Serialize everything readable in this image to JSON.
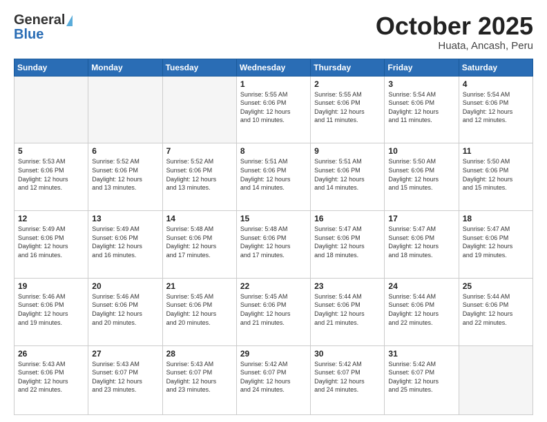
{
  "header": {
    "logo_general": "General",
    "logo_blue": "Blue",
    "month_title": "October 2025",
    "location": "Huata, Ancash, Peru"
  },
  "days_of_week": [
    "Sunday",
    "Monday",
    "Tuesday",
    "Wednesday",
    "Thursday",
    "Friday",
    "Saturday"
  ],
  "weeks": [
    [
      {
        "day": "",
        "info": ""
      },
      {
        "day": "",
        "info": ""
      },
      {
        "day": "",
        "info": ""
      },
      {
        "day": "1",
        "info": "Sunrise: 5:55 AM\nSunset: 6:06 PM\nDaylight: 12 hours\nand 10 minutes."
      },
      {
        "day": "2",
        "info": "Sunrise: 5:55 AM\nSunset: 6:06 PM\nDaylight: 12 hours\nand 11 minutes."
      },
      {
        "day": "3",
        "info": "Sunrise: 5:54 AM\nSunset: 6:06 PM\nDaylight: 12 hours\nand 11 minutes."
      },
      {
        "day": "4",
        "info": "Sunrise: 5:54 AM\nSunset: 6:06 PM\nDaylight: 12 hours\nand 12 minutes."
      }
    ],
    [
      {
        "day": "5",
        "info": "Sunrise: 5:53 AM\nSunset: 6:06 PM\nDaylight: 12 hours\nand 12 minutes."
      },
      {
        "day": "6",
        "info": "Sunrise: 5:52 AM\nSunset: 6:06 PM\nDaylight: 12 hours\nand 13 minutes."
      },
      {
        "day": "7",
        "info": "Sunrise: 5:52 AM\nSunset: 6:06 PM\nDaylight: 12 hours\nand 13 minutes."
      },
      {
        "day": "8",
        "info": "Sunrise: 5:51 AM\nSunset: 6:06 PM\nDaylight: 12 hours\nand 14 minutes."
      },
      {
        "day": "9",
        "info": "Sunrise: 5:51 AM\nSunset: 6:06 PM\nDaylight: 12 hours\nand 14 minutes."
      },
      {
        "day": "10",
        "info": "Sunrise: 5:50 AM\nSunset: 6:06 PM\nDaylight: 12 hours\nand 15 minutes."
      },
      {
        "day": "11",
        "info": "Sunrise: 5:50 AM\nSunset: 6:06 PM\nDaylight: 12 hours\nand 15 minutes."
      }
    ],
    [
      {
        "day": "12",
        "info": "Sunrise: 5:49 AM\nSunset: 6:06 PM\nDaylight: 12 hours\nand 16 minutes."
      },
      {
        "day": "13",
        "info": "Sunrise: 5:49 AM\nSunset: 6:06 PM\nDaylight: 12 hours\nand 16 minutes."
      },
      {
        "day": "14",
        "info": "Sunrise: 5:48 AM\nSunset: 6:06 PM\nDaylight: 12 hours\nand 17 minutes."
      },
      {
        "day": "15",
        "info": "Sunrise: 5:48 AM\nSunset: 6:06 PM\nDaylight: 12 hours\nand 17 minutes."
      },
      {
        "day": "16",
        "info": "Sunrise: 5:47 AM\nSunset: 6:06 PM\nDaylight: 12 hours\nand 18 minutes."
      },
      {
        "day": "17",
        "info": "Sunrise: 5:47 AM\nSunset: 6:06 PM\nDaylight: 12 hours\nand 18 minutes."
      },
      {
        "day": "18",
        "info": "Sunrise: 5:47 AM\nSunset: 6:06 PM\nDaylight: 12 hours\nand 19 minutes."
      }
    ],
    [
      {
        "day": "19",
        "info": "Sunrise: 5:46 AM\nSunset: 6:06 PM\nDaylight: 12 hours\nand 19 minutes."
      },
      {
        "day": "20",
        "info": "Sunrise: 5:46 AM\nSunset: 6:06 PM\nDaylight: 12 hours\nand 20 minutes."
      },
      {
        "day": "21",
        "info": "Sunrise: 5:45 AM\nSunset: 6:06 PM\nDaylight: 12 hours\nand 20 minutes."
      },
      {
        "day": "22",
        "info": "Sunrise: 5:45 AM\nSunset: 6:06 PM\nDaylight: 12 hours\nand 21 minutes."
      },
      {
        "day": "23",
        "info": "Sunrise: 5:44 AM\nSunset: 6:06 PM\nDaylight: 12 hours\nand 21 minutes."
      },
      {
        "day": "24",
        "info": "Sunrise: 5:44 AM\nSunset: 6:06 PM\nDaylight: 12 hours\nand 22 minutes."
      },
      {
        "day": "25",
        "info": "Sunrise: 5:44 AM\nSunset: 6:06 PM\nDaylight: 12 hours\nand 22 minutes."
      }
    ],
    [
      {
        "day": "26",
        "info": "Sunrise: 5:43 AM\nSunset: 6:06 PM\nDaylight: 12 hours\nand 22 minutes."
      },
      {
        "day": "27",
        "info": "Sunrise: 5:43 AM\nSunset: 6:07 PM\nDaylight: 12 hours\nand 23 minutes."
      },
      {
        "day": "28",
        "info": "Sunrise: 5:43 AM\nSunset: 6:07 PM\nDaylight: 12 hours\nand 23 minutes."
      },
      {
        "day": "29",
        "info": "Sunrise: 5:42 AM\nSunset: 6:07 PM\nDaylight: 12 hours\nand 24 minutes."
      },
      {
        "day": "30",
        "info": "Sunrise: 5:42 AM\nSunset: 6:07 PM\nDaylight: 12 hours\nand 24 minutes."
      },
      {
        "day": "31",
        "info": "Sunrise: 5:42 AM\nSunset: 6:07 PM\nDaylight: 12 hours\nand 25 minutes."
      },
      {
        "day": "",
        "info": ""
      }
    ]
  ]
}
